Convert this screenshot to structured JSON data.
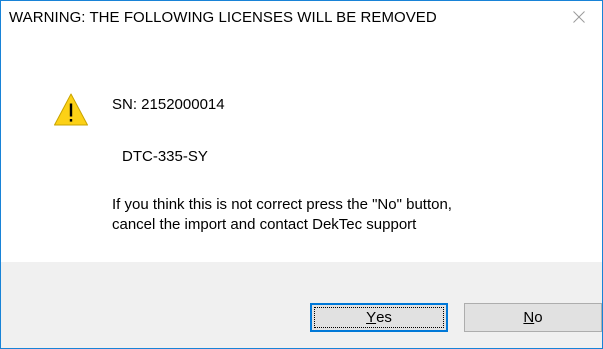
{
  "window": {
    "title": "WARNING: THE FOLLOWING LICENSES WILL BE REMOVED",
    "close_icon": "close-icon",
    "accent_color": "#1883d7"
  },
  "message": {
    "icon": "warning-icon",
    "serial": "SN: 2152000014",
    "product": "DTC-335-SY",
    "line1": "If you think this is not correct press the \"No\" button,",
    "line2": "cancel the import and contact DekTec support"
  },
  "buttons": {
    "yes": {
      "mnemonic": "Y",
      "rest": "es",
      "focused": true
    },
    "no": {
      "mnemonic": "N",
      "rest": "o"
    }
  }
}
